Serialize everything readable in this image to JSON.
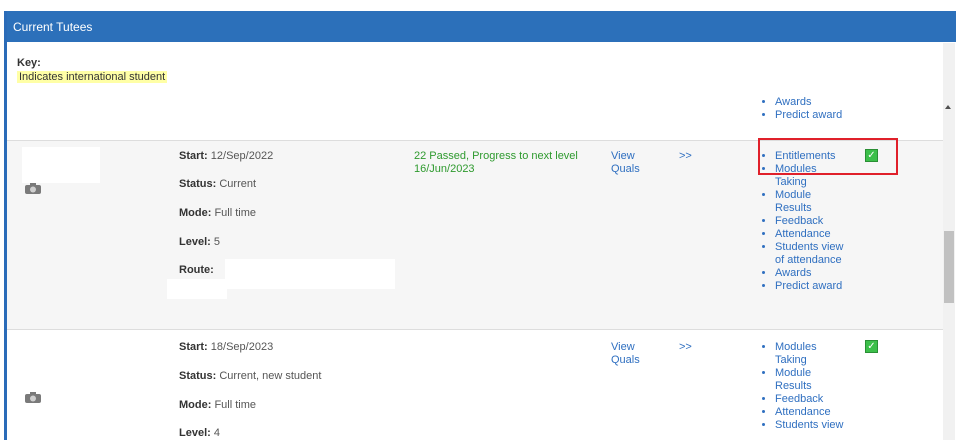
{
  "panel": {
    "title": "Current Tutees"
  },
  "key": {
    "label": "Key:",
    "note": "Indicates international student"
  },
  "row1": {
    "links": [
      "Awards",
      "Predict award"
    ]
  },
  "row2": {
    "start_label": "Start:",
    "start": "12/Sep/2022",
    "status_label": "Status:",
    "status": "Current",
    "mode_label": "Mode:",
    "mode": "Full time",
    "level_label": "Level:",
    "level": "5",
    "route_label": "Route:",
    "progress_line1": "22 Passed, Progress to next level",
    "progress_line2": "16/Jun/2023",
    "view_quals_1": "View",
    "view_quals_2": "Quals",
    "arrow": ">>",
    "links": [
      "Entitlements",
      "Modules",
      "Taking",
      "Module",
      "Results",
      "Feedback",
      "Attendance",
      "Students view",
      "of attendance",
      "Awards",
      "Predict award"
    ]
  },
  "row3": {
    "start_label": "Start:",
    "start": "18/Sep/2023",
    "status_label": "Status:",
    "status": "Current, new student",
    "mode_label": "Mode:",
    "mode": "Full time",
    "level_label": "Level:",
    "level": "4",
    "view_quals_1": "View",
    "view_quals_2": "Quals",
    "arrow": ">>",
    "links": [
      "Modules",
      "Taking",
      "Module",
      "Results",
      "Feedback",
      "Attendance",
      "Students view"
    ]
  },
  "colors": {
    "header": "#2c70ba",
    "link": "#2f6fc0",
    "progress": "#2e9a2e",
    "key_highlight": "#ffffa6",
    "annotation": "#e0202a"
  },
  "icons": {
    "photo": "student-photo-icon",
    "check": "checkbox-checked-icon"
  }
}
